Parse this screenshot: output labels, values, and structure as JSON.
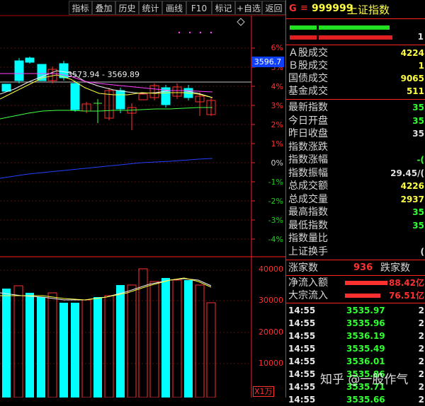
{
  "toolbar": {
    "buttons": [
      "指标",
      "叠加",
      "历史",
      "统计",
      "画线",
      "F10",
      "标记",
      "+自选",
      "返回"
    ]
  },
  "chart": {
    "price_axis": [
      "6%",
      "5%",
      "4%",
      "3%",
      "2%",
      "1%",
      "0%",
      "-1%",
      "-2%",
      "-3%",
      "-4%"
    ],
    "current_price_tag": "3596.7",
    "range_label": "3573.94 - 3569.89",
    "volume_axis": [
      "40000",
      "30000",
      "20000",
      "10000"
    ],
    "volume_unit": "X1万",
    "colors": {
      "up": "#00ffff",
      "down": "#ff3030",
      "ma_white": "#f0f0f0",
      "ma_yellow": "#ffff40",
      "ma_pink": "#ff40ff",
      "ma_green": "#40ff40",
      "blue": "#2040ff"
    }
  },
  "panel": {
    "code": "999999",
    "name": "上证指数",
    "g_label": "G",
    "menu_icon": "≡",
    "right_value": "1",
    "rows": [
      {
        "label": "Ａ股成交",
        "value": "4224"
      },
      {
        "label": "Ｂ股成交",
        "value": "1"
      },
      {
        "label": "国债成交",
        "value": "9065"
      },
      {
        "label": "基金成交",
        "value": "511"
      }
    ],
    "stats": [
      {
        "label": "最新指数",
        "value": "35"
      },
      {
        "label": "今日开盘",
        "value": "35"
      },
      {
        "label": "昨日收盘",
        "value": "35"
      },
      {
        "label": "指数涨跌",
        "value": ""
      },
      {
        "label": "指数涨幅",
        "value": "-("
      },
      {
        "label": "指数振幅",
        "value": "29.45/("
      },
      {
        "label": "总成交额",
        "value": "4226"
      },
      {
        "label": "总成交量",
        "value": "2937"
      },
      {
        "label": "最高指数",
        "value": "35"
      },
      {
        "label": "最低指数",
        "value": "35"
      },
      {
        "label": "指数量比",
        "value": ""
      },
      {
        "label": "上证换手",
        "value": "("
      }
    ],
    "advance_label": "涨家数",
    "advance_value": "936",
    "decline_label": "跌家数",
    "inflow_label": "净流入额",
    "inflow_value": "88.42亿",
    "block_label": "大宗流入",
    "block_value": "76.51亿",
    "ticks": [
      {
        "time": "14:55",
        "price": "3535.97",
        "vol": "2"
      },
      {
        "time": "14:55",
        "price": "3535.96",
        "vol": "2"
      },
      {
        "time": "14:55",
        "price": "3536.19",
        "vol": "2"
      },
      {
        "time": "14:55",
        "price": "3535.49",
        "vol": "2"
      },
      {
        "time": "14:55",
        "price": "3536.01",
        "vol": "2"
      },
      {
        "time": "14:55",
        "price": "3535.86",
        "vol": "2"
      },
      {
        "time": "14:55",
        "price": "3535.71",
        "vol": "2"
      },
      {
        "time": "14:55",
        "price": "3535.66",
        "vol": "2"
      }
    ]
  },
  "watermark": "知乎 @一股作气"
}
